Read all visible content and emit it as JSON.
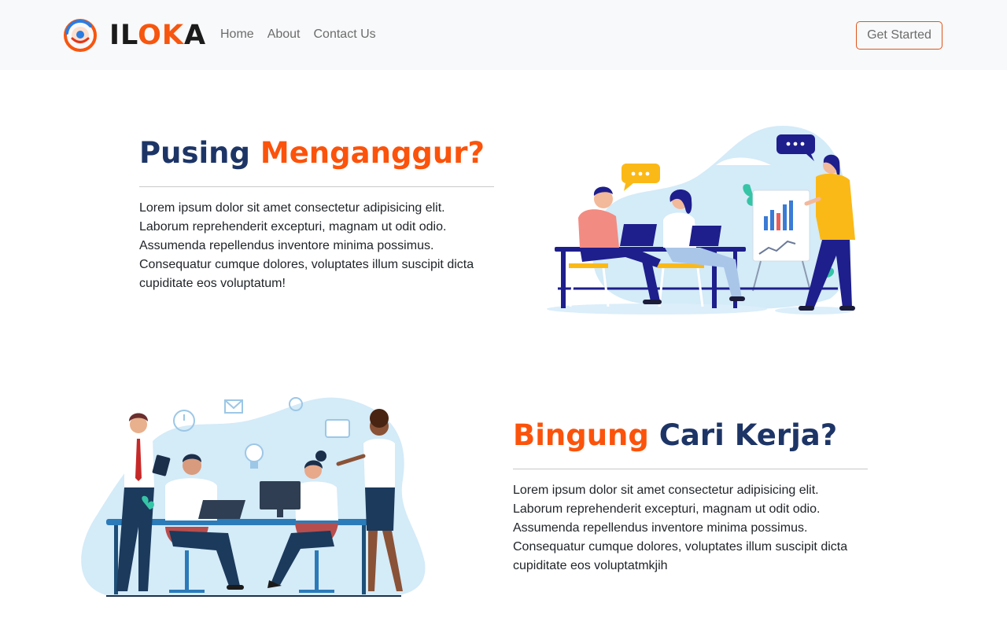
{
  "brand": {
    "name_part1": "IL",
    "name_part2": "OK",
    "name_part3": "A",
    "logo_icon": "iloka-logo-icon"
  },
  "nav": {
    "links": [
      "Home",
      "About",
      "Contact Us"
    ],
    "cta_label": "Get Started"
  },
  "section1": {
    "title_part1": "Pusing",
    "title_part2": "Menganggur?",
    "body": "Lorem ipsum dolor sit amet consectetur adipisicing elit. Laborum reprehenderit excepturi, magnam ut odit odio. Assumenda repellendus inventore minima possimus. Consequatur cumque dolores, voluptates illum suscipit dicta cupiditate eos voluptatum!",
    "illustration": "team-meeting-presentation-illustration"
  },
  "section2": {
    "title_part1": "Bingung",
    "title_part2": "Cari Kerja?",
    "body": "Lorem ipsum dolor sit amet consectetur adipisicing elit. Laborum reprehenderit excepturi, magnam ut odit odio. Assumenda repellendus inventore minima possimus. Consequatur cumque dolores, voluptates illum suscipit dicta cupiditate eos voluptatmkjih",
    "illustration": "office-coworking-illustration"
  },
  "colors": {
    "navy": "#1d3566",
    "orange": "#fb530b",
    "navbar_bg": "#f8f9fa"
  }
}
